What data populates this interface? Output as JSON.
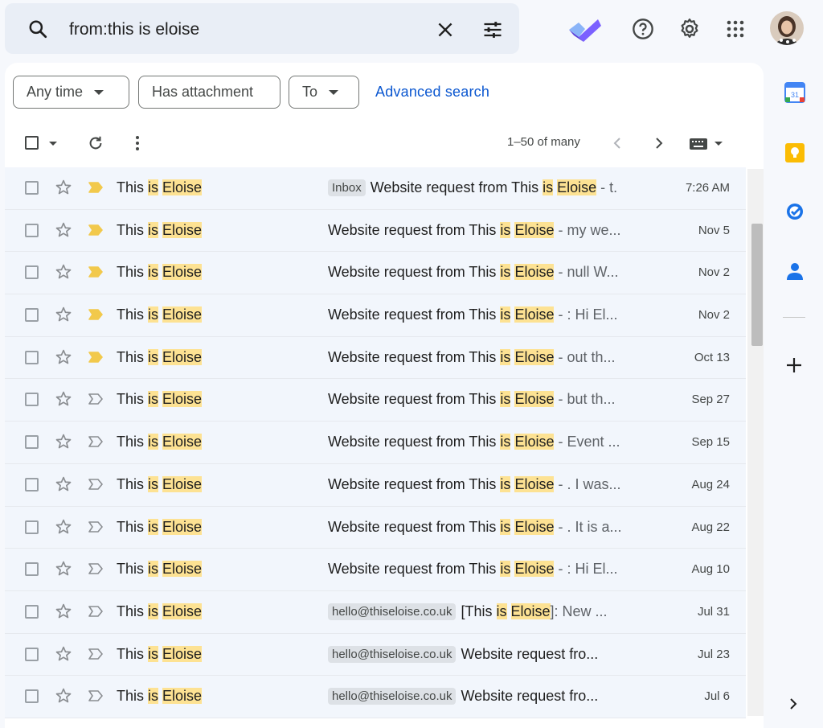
{
  "search": {
    "query": "from:this is eloise"
  },
  "filters": {
    "chips": [
      "Any time",
      "Has attachment",
      "To"
    ],
    "advanced_search": "Advanced search"
  },
  "toolbar": {
    "pagination": "1–50 of many"
  },
  "emails": [
    {
      "sender_pre": "This ",
      "sender_hl1": "is",
      "sender_mid": " ",
      "sender_hl2": "Eloise",
      "label": "Inbox",
      "subject": "Website request from This ",
      "subject_hl1": "is",
      "subject_hl2": "Eloise",
      "snippet": " - t.",
      "date": "7:26 AM",
      "important": true
    },
    {
      "sender_pre": "This ",
      "sender_hl1": "is",
      "sender_mid": " ",
      "sender_hl2": "Eloise",
      "label": "",
      "subject": "Website request from This ",
      "subject_hl1": "is",
      "subject_hl2": "Eloise",
      "snippet": " - my we...",
      "date": "Nov 5",
      "important": true
    },
    {
      "sender_pre": "This ",
      "sender_hl1": "is",
      "sender_mid": " ",
      "sender_hl2": "Eloise",
      "label": "",
      "subject": "Website request from This ",
      "subject_hl1": "is",
      "subject_hl2": "Eloise",
      "snippet": " - null W...",
      "date": "Nov 2",
      "important": true
    },
    {
      "sender_pre": "This ",
      "sender_hl1": "is",
      "sender_mid": " ",
      "sender_hl2": "Eloise",
      "label": "",
      "subject": "Website request from This ",
      "subject_hl1": "is",
      "subject_hl2": "Eloise",
      "snippet": " - : Hi El...",
      "date": "Nov 2",
      "important": true
    },
    {
      "sender_pre": "This ",
      "sender_hl1": "is",
      "sender_mid": " ",
      "sender_hl2": "Eloise",
      "label": "",
      "subject": "Website request from This ",
      "subject_hl1": "is",
      "subject_hl2": "Eloise",
      "snippet": " - out th...",
      "date": "Oct 13",
      "important": true
    },
    {
      "sender_pre": "This ",
      "sender_hl1": "is",
      "sender_mid": " ",
      "sender_hl2": "Eloise",
      "label": "",
      "subject": "Website request from This ",
      "subject_hl1": "is",
      "subject_hl2": "Eloise",
      "snippet": " - but th...",
      "date": "Sep 27",
      "important": false
    },
    {
      "sender_pre": "This ",
      "sender_hl1": "is",
      "sender_mid": " ",
      "sender_hl2": "Eloise",
      "label": "",
      "subject": "Website request from This ",
      "subject_hl1": "is",
      "subject_hl2": "Eloise",
      "snippet": " - Event ...",
      "date": "Sep 15",
      "important": false
    },
    {
      "sender_pre": "This ",
      "sender_hl1": "is",
      "sender_mid": " ",
      "sender_hl2": "Eloise",
      "label": "",
      "subject": "Website request from This ",
      "subject_hl1": "is",
      "subject_hl2": "Eloise",
      "snippet": " - . I was...",
      "date": "Aug 24",
      "important": false
    },
    {
      "sender_pre": "This ",
      "sender_hl1": "is",
      "sender_mid": " ",
      "sender_hl2": "Eloise",
      "label": "",
      "subject": "Website request from This ",
      "subject_hl1": "is",
      "subject_hl2": "Eloise",
      "snippet": " - . It is a...",
      "date": "Aug 22",
      "important": false
    },
    {
      "sender_pre": "This ",
      "sender_hl1": "is",
      "sender_mid": " ",
      "sender_hl2": "Eloise",
      "label": "",
      "subject": "Website request from This ",
      "subject_hl1": "is",
      "subject_hl2": "Eloise",
      "snippet": " - : Hi El...",
      "date": "Aug 10",
      "important": false
    },
    {
      "sender_pre": "This ",
      "sender_hl1": "is",
      "sender_mid": " ",
      "sender_hl2": "Eloise",
      "label": "hello@thiseloise.co.uk",
      "subject": "[This ",
      "subject_hl1": "is",
      "subject_hl2": "Eloise",
      "snippet": "]: New ...",
      "date": "Jul 31",
      "important": false
    },
    {
      "sender_pre": "This ",
      "sender_hl1": "is",
      "sender_mid": " ",
      "sender_hl2": "Eloise",
      "label": "hello@thiseloise.co.uk",
      "subject": "Website request fro...",
      "subject_hl1": "",
      "subject_hl2": "",
      "snippet": "",
      "date": "Jul 23",
      "important": false
    },
    {
      "sender_pre": "This ",
      "sender_hl1": "is",
      "sender_mid": " ",
      "sender_hl2": "Eloise",
      "label": "hello@thiseloise.co.uk",
      "subject": "Website request fro...",
      "subject_hl1": "",
      "subject_hl2": "",
      "snippet": "",
      "date": "Jul 6",
      "important": false
    }
  ],
  "colors": {
    "accent": "#0b57d0",
    "highlight": "#fde293",
    "important": "#f2c94c"
  }
}
